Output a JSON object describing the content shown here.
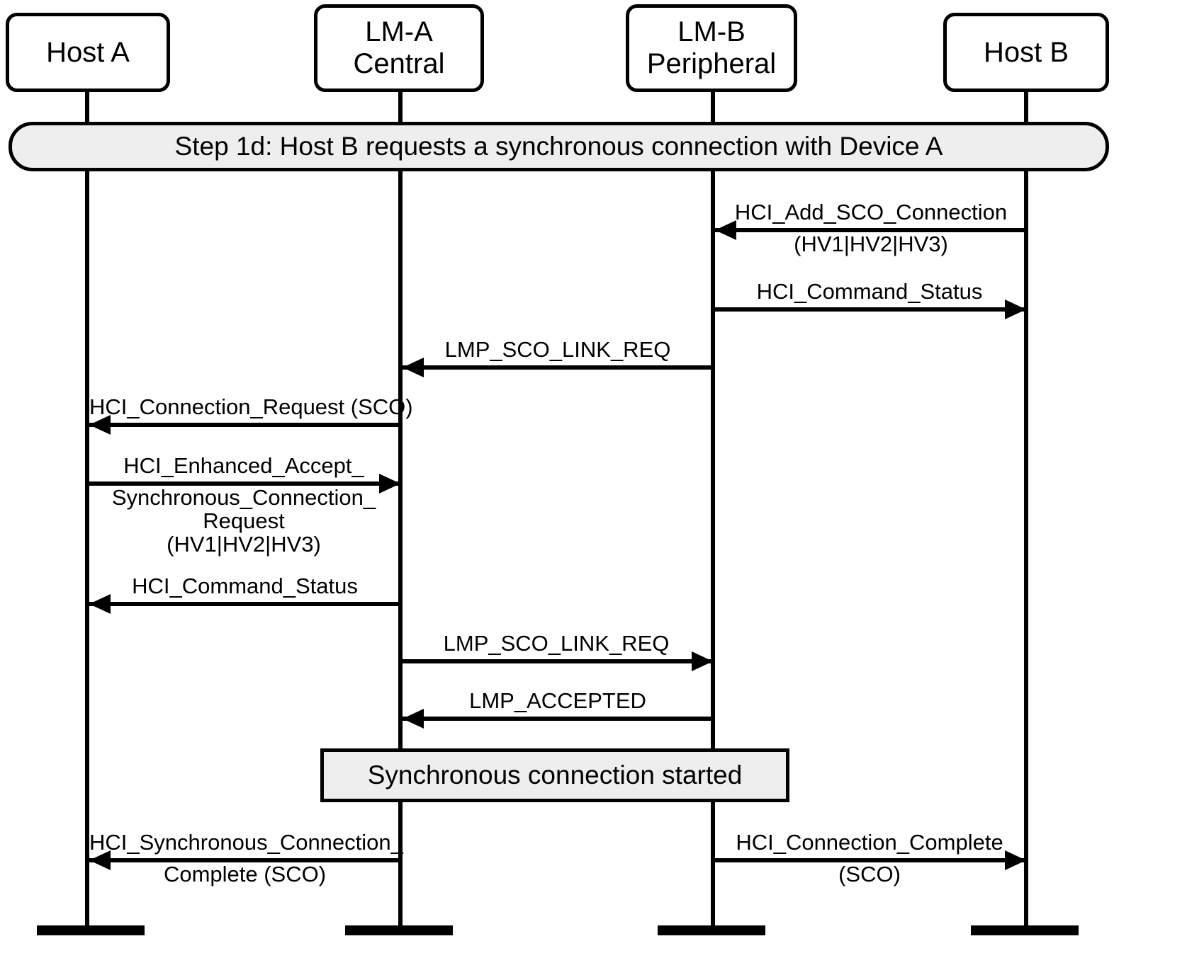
{
  "diagram": {
    "title": "Step 1d: Host B requests a synchronous connection with Device A",
    "type": "sequence-diagram"
  },
  "actors": [
    {
      "id": "host-a",
      "line1": "Host A",
      "line2": ""
    },
    {
      "id": "lm-a",
      "line1": "LM-A",
      "line2": "Central"
    },
    {
      "id": "lm-b",
      "line1": "LM-B",
      "line2": "Peripheral"
    },
    {
      "id": "host-b",
      "line1": "Host B",
      "line2": ""
    }
  ],
  "banner": {
    "text": "Step 1d:  Host B requests a synchronous connection with Device A"
  },
  "note": {
    "text": "Synchronous connection started"
  },
  "messages": [
    {
      "id": "m1",
      "above": "HCI_Add_SCO_Connection",
      "below": "(HV1|HV2|HV3)",
      "from": "host-b",
      "to": "lm-b",
      "direction": "left"
    },
    {
      "id": "m2",
      "above": "HCI_Command_Status",
      "below": "",
      "from": "lm-b",
      "to": "host-b",
      "direction": "right"
    },
    {
      "id": "m3",
      "above": "LMP_SCO_LINK_REQ",
      "below": "",
      "from": "lm-b",
      "to": "lm-a",
      "direction": "left"
    },
    {
      "id": "m4",
      "above": "HCI_Connection_Request (SCO)",
      "below": "",
      "from": "lm-a",
      "to": "host-a",
      "direction": "left"
    },
    {
      "id": "m5",
      "above": "HCI_Enhanced_Accept_",
      "below": "Synchronous_Connection_\nRequest\n(HV1|HV2|HV3)",
      "from": "host-a",
      "to": "lm-a",
      "direction": "right"
    },
    {
      "id": "m6",
      "above": "HCI_Command_Status",
      "below": "",
      "from": "lm-a",
      "to": "host-a",
      "direction": "left"
    },
    {
      "id": "m7",
      "above": "LMP_SCO_LINK_REQ",
      "below": "",
      "from": "lm-a",
      "to": "lm-b",
      "direction": "right"
    },
    {
      "id": "m8",
      "above": "LMP_ACCEPTED",
      "below": "",
      "from": "lm-b",
      "to": "lm-a",
      "direction": "left"
    },
    {
      "id": "m9",
      "above": "HCI_Synchronous_Connection_",
      "below": "Complete (SCO)",
      "from": "lm-a",
      "to": "host-a",
      "direction": "left"
    },
    {
      "id": "m10",
      "above": "HCI_Connection_Complete",
      "below": "(SCO)",
      "from": "lm-b",
      "to": "host-b",
      "direction": "right"
    }
  ],
  "colors": {
    "stroke": "#000000",
    "banner_fill": "#eeeeee",
    "note_fill": "#eeeeee",
    "background": "#ffffff"
  }
}
